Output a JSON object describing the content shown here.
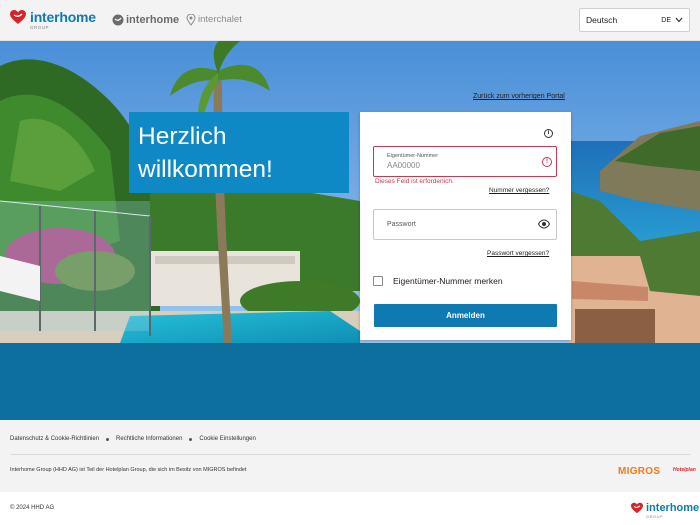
{
  "header": {
    "brand_primary": "interhome",
    "brand_primary_sub": "GROUP",
    "brand_secondary": "interhome",
    "brand_tertiary": "interchalet",
    "language": {
      "label": "Deutsch",
      "code": "DE"
    }
  },
  "hero": {
    "back_link": "Zurück zum vorherigen Portal",
    "welcome_line1": "Herzlich",
    "welcome_line2": "willkommen!"
  },
  "login": {
    "owner_number_label": "Eigentümer-Nummer",
    "owner_number_placeholder": "AA00000",
    "error_message": "Dieses Feld ist erforderlich.",
    "forgot_number": "Nummer vergessen?",
    "password_placeholder": "Passwort",
    "forgot_password": "Passwort vergessen?",
    "remember_label": "Eigentümer-Nummer merken",
    "submit_label": "Anmelden"
  },
  "footer": {
    "links": [
      "Datenschutz & Cookie-Richtlinien",
      "Rechtliche Informationen",
      "Cookie Einstellungen"
    ],
    "info": "Interhome Group (HHD AG) ist Teil der Hotelplan Group, die sich im Besitz von MIGROS befindet",
    "migros": "MIGROS",
    "hotelplan": "Hotelplan",
    "copyright": "© 2024 HHD AG",
    "brand": "interhome",
    "brand_sub": "GROUP"
  },
  "colors": {
    "brand_blue": "#0f7ab2",
    "welcome_blue": "#0f89c5",
    "band_blue": "#0d6f9e",
    "error_red": "#c9384f",
    "migros_orange": "#f07a1a"
  }
}
